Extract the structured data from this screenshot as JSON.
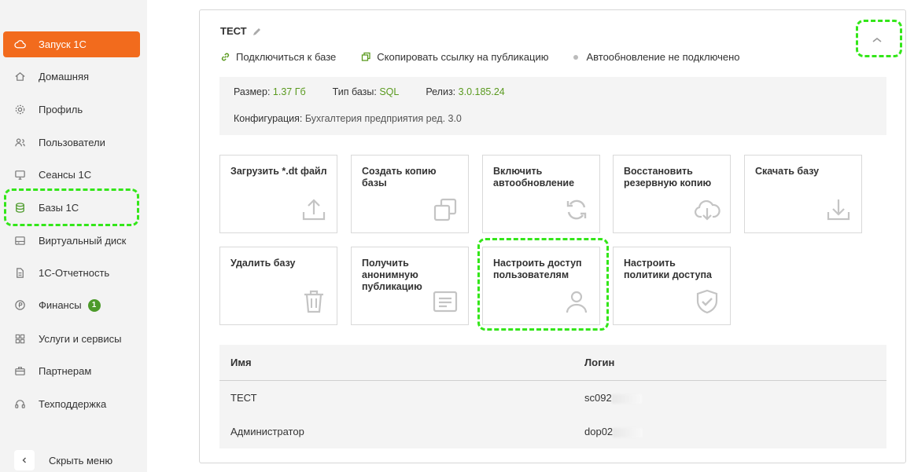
{
  "sidebar": {
    "items": [
      {
        "label": "Запуск 1С",
        "icon": "cloud-icon",
        "active": true
      },
      {
        "label": "Домашняя",
        "icon": "home-icon"
      },
      {
        "label": "Профиль",
        "icon": "gear-icon"
      },
      {
        "label": "Пользователи",
        "icon": "users-icon"
      },
      {
        "label": "Сеансы 1С",
        "icon": "monitor-icon"
      },
      {
        "label": "Базы 1С",
        "icon": "database-icon"
      },
      {
        "label": "Виртуальный диск",
        "icon": "disk-icon"
      },
      {
        "label": "1С-Отчетность",
        "icon": "document-icon"
      },
      {
        "label": "Финансы",
        "icon": "ruble-icon",
        "badge": "1"
      },
      {
        "label": "Услуги и сервисы",
        "icon": "grid-icon"
      },
      {
        "label": "Партнерам",
        "icon": "briefcase-icon"
      },
      {
        "label": "Техподдержка",
        "icon": "headset-icon"
      }
    ],
    "hide_menu": "Скрыть меню"
  },
  "card": {
    "title": "ТЕСТ",
    "actions": {
      "connect": "Подключиться к базе",
      "copy_link": "Скопировать ссылку на публикацию",
      "autoupdate_status": "Автообновление не подключено"
    },
    "info": {
      "size_label": "Размер:",
      "size_value": "1.37 Гб",
      "type_label": "Тип базы:",
      "type_value": "SQL",
      "release_label": "Релиз:",
      "release_value": "3.0.185.24",
      "config_label": "Конфигурация:",
      "config_value": "Бухгалтерия предприятия ред. 3.0"
    },
    "tiles": [
      {
        "label": "Загрузить *.dt файл",
        "icon": "upload-icon"
      },
      {
        "label": "Создать копию базы",
        "icon": "copy-icon"
      },
      {
        "label": "Включить автообновление",
        "icon": "refresh-icon"
      },
      {
        "label": "Восстановить резервную копию",
        "icon": "cloud-download-icon"
      },
      {
        "label": "Скачать базу",
        "icon": "download-icon"
      },
      {
        "label": "Удалить базу",
        "icon": "trash-icon"
      },
      {
        "label": "Получить анонимную публикацию",
        "icon": "form-icon"
      },
      {
        "label": "Настроить доступ пользователям",
        "icon": "user-icon"
      },
      {
        "label": "Настроить политики доступа",
        "icon": "shield-check-icon"
      }
    ],
    "table": {
      "headers": {
        "name": "Имя",
        "login": "Логин"
      },
      "rows": [
        {
          "name": "ТЕСТ",
          "login": "sc092"
        },
        {
          "name": "Администратор",
          "login": "dop02"
        }
      ]
    }
  },
  "colors": {
    "accent": "#f26b1d",
    "green": "#5a9a1f",
    "highlight": "#33e619"
  }
}
